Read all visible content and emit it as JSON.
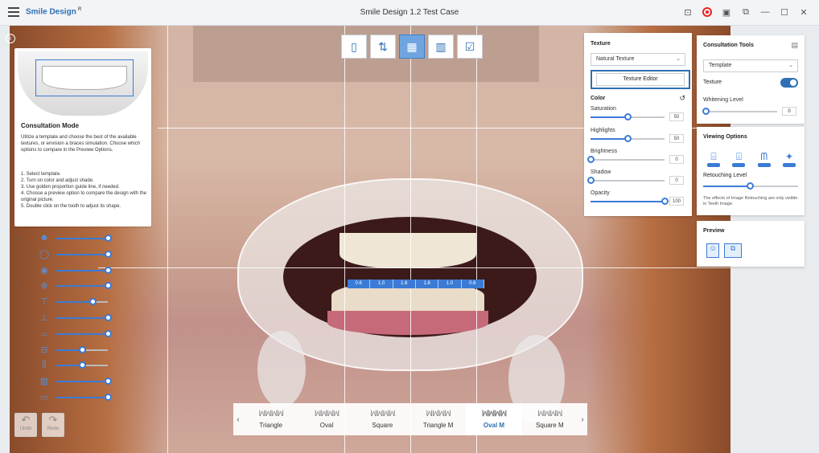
{
  "titlebar": {
    "app_name": "Smile Design",
    "app_sup": "R",
    "document_title": "Smile Design 1.2 Test Case",
    "icons": [
      "screenshot-icon",
      "record-icon",
      "capture-icon",
      "window-icon",
      "minimize-icon",
      "maximize-icon",
      "close-icon"
    ]
  },
  "top_tools": {
    "icons": [
      "face-view-icon",
      "alignment-icon",
      "teeth-design-icon",
      "tooth-library-icon",
      "checklist-icon"
    ],
    "active_index": 2
  },
  "consultation": {
    "title": "Consultation Mode",
    "description": "Utilize a template and choose the best of the available textures, or envision a braces simulation. Choose which options to compare in the Preview Options.",
    "steps": [
      "1. Select template.",
      "2. Turn on color and adjust shade.",
      "3. Use golden proportion guide line, if needed.",
      "4. Choose a preview option to compare the design with the original picture.",
      "5. Double click on the tooth to adjust its shape."
    ]
  },
  "proportion_values": [
    "0.6",
    "1.0",
    "1.6",
    "1.6",
    "1.0",
    "0.6"
  ],
  "undo_redo": {
    "undo": "Undo",
    "redo": "Redo"
  },
  "templates": {
    "items": [
      "Triangle",
      "Oval",
      "Square",
      "Triangle M",
      "Oval M",
      "Square M"
    ],
    "active": "Oval M"
  },
  "texture_panel": {
    "title": "Texture",
    "texture_select": "Natural Texture",
    "editor_button": "Texture Editor",
    "color_title": "Color",
    "sliders": [
      {
        "label": "Saturation",
        "value": "50",
        "level": 0.5
      },
      {
        "label": "Highlights",
        "value": "50",
        "level": 0.5
      },
      {
        "label": "Brightness",
        "value": "0",
        "level": 0.0
      },
      {
        "label": "Shadow",
        "value": "0",
        "level": 0.0
      },
      {
        "label": "Opacity",
        "value": "100",
        "level": 1.0
      }
    ]
  },
  "consultation_tools": {
    "title": "Consultation Tools",
    "template_select": "Template",
    "texture_label": "Texture",
    "texture_on": true,
    "whitening_label": "Whitening Level",
    "whitening_value": "0"
  },
  "viewing_options": {
    "title": "Viewing Options",
    "icons": [
      "braces-metal-icon",
      "braces-ceramic-icon",
      "teeth-outline-icon",
      "teeth-sparkle-icon"
    ],
    "retouching_label": "Retouching Level",
    "retouching_level": 0.5,
    "note": "The effects of Image Retouching are only visible in Teeth Image."
  },
  "preview": {
    "title": "Preview",
    "icons": [
      "preview-single-icon",
      "preview-compare-icon"
    ]
  },
  "left_controls": {
    "rows": [
      {
        "name": "face-guide",
        "level": 1.0,
        "arrow": true
      },
      {
        "name": "lip-line",
        "level": 1.0,
        "arrow": false
      },
      {
        "name": "tooth-outline",
        "level": 1.0,
        "arrow": false
      },
      {
        "name": "midline",
        "level": 1.0,
        "arrow": true
      },
      {
        "name": "vertical-guide",
        "level": 0.7,
        "arrow": false
      },
      {
        "name": "cross-guide",
        "level": 1.0,
        "arrow": false
      },
      {
        "name": "smile-arc",
        "level": 1.0,
        "arrow": false
      },
      {
        "name": "golden-ratio",
        "level": 0.5,
        "arrow": false
      },
      {
        "name": "tooth-axis",
        "level": 0.5,
        "arrow": false
      },
      {
        "name": "template-grid",
        "level": 1.0,
        "arrow": true
      },
      {
        "name": "tooth-width",
        "level": 1.0,
        "arrow": false
      }
    ]
  },
  "colors": {
    "accent": "#2f6fb3",
    "slider": "#3b7bd6",
    "record": "#e22222"
  }
}
